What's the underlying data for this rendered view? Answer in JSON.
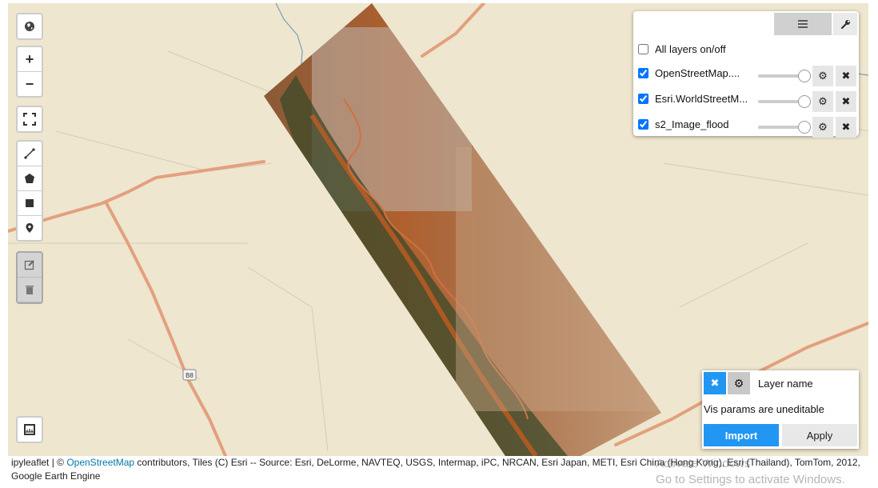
{
  "map": {
    "road_shield": "B8",
    "colors": {
      "land": "#eee6cf",
      "road": "#e3a07e",
      "water": "#7e9fb8"
    }
  },
  "left_controls": {
    "basemap_icon": "globe-icon",
    "zoom_in": "+",
    "zoom_out": "−",
    "fullscreen_icon": "fullscreen-icon",
    "draw_tools": [
      "polyline-icon",
      "polygon-icon",
      "rectangle-icon",
      "marker-icon"
    ],
    "edit_tools": [
      "edit-icon",
      "trash-icon"
    ],
    "measure_icon": "ruler-icon"
  },
  "layer_panel": {
    "all_layers_label": "All layers on/off",
    "layers": [
      {
        "name": "OpenStreetMap....",
        "checked": true,
        "opacity": 1.0
      },
      {
        "name": "Esri.WorldStreetM...",
        "checked": true,
        "opacity": 1.0
      },
      {
        "name": "s2_Image_flood",
        "checked": true,
        "opacity": 1.0
      }
    ]
  },
  "vis_panel": {
    "layer_name": "Layer name",
    "message": "Vis params are uneditable",
    "import_label": "Import",
    "apply_label": "Apply",
    "import_color": "#2196f3"
  },
  "attribution": {
    "prefix": "ipyleaflet | © ",
    "osm_link": "OpenStreetMap",
    "rest": " contributors, Tiles (C) Esri -- Source: Esri, DeLorme, NAVTEQ, USGS, Intermap, iPC, NRCAN, Esri Japan, METI, Esri China (Hong Kong), Esri (Thailand), TomTom, 2012,",
    "line2": "Google Earth Engine"
  },
  "watermark": {
    "line1": "Activate Windows",
    "line2": "Go to Settings to activate Windows."
  }
}
